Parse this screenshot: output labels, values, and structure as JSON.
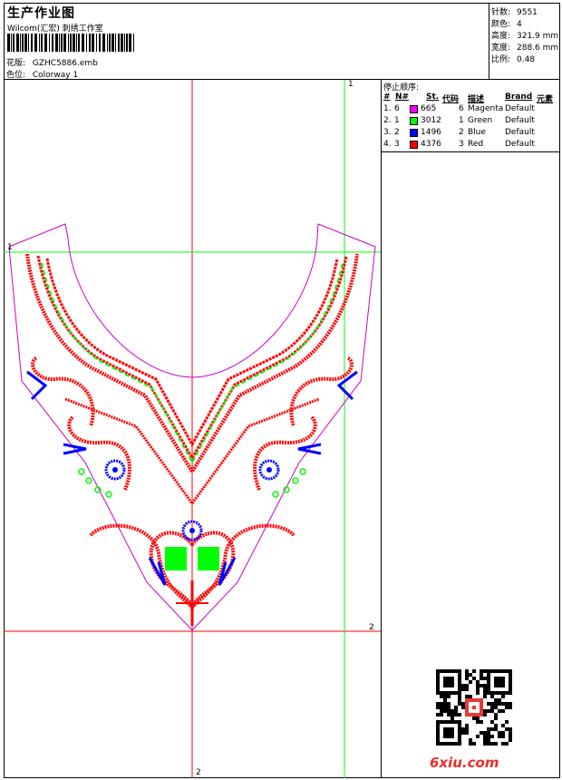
{
  "header": {
    "title": "生产作业图",
    "company": "Wilcom(汇宏) 刺绣工作室",
    "design_label": "花版:",
    "design_value": "GZHC5886.emb",
    "colorway_label": "色位:",
    "colorway_value": "Colorway 1"
  },
  "stats": [
    {
      "label": "针数:",
      "value": "9551"
    },
    {
      "label": "颜色:",
      "value": "4"
    },
    {
      "label": "高度:",
      "value": "321.9 mm"
    },
    {
      "label": "宽度:",
      "value": "288.6 mm"
    },
    {
      "label": "比例:",
      "value": "0.48"
    }
  ],
  "stop_sequence": {
    "title": "停止顺序:",
    "columns": [
      "#",
      "N#",
      "St.",
      "代码",
      "描述",
      "Brand",
      "元素"
    ],
    "rows": [
      {
        "num": "1.",
        "n": "6",
        "color": "#ff00ff",
        "stitches": "665",
        "code": "6",
        "desc": "Magenta",
        "brand": "Default"
      },
      {
        "num": "2.",
        "n": "1",
        "color": "#00ff00",
        "stitches": "3012",
        "code": "1",
        "desc": "Green",
        "brand": "Default"
      },
      {
        "num": "3.",
        "n": "2",
        "color": "#0000ff",
        "stitches": "1496",
        "code": "2",
        "desc": "Blue",
        "brand": "Default"
      },
      {
        "num": "4.",
        "n": "3",
        "color": "#ff0000",
        "stitches": "4376",
        "code": "3",
        "desc": "Red",
        "brand": "Default"
      }
    ]
  },
  "guides": {
    "green_v_label": "1",
    "green_h_label": "1",
    "red_h_label": "2",
    "red_v_label": "2"
  },
  "watermark": "6xiu.com",
  "colors": {
    "magenta": "#cc00cc",
    "green": "#00ff00",
    "blue": "#0000ff",
    "red": "#ff0000"
  }
}
